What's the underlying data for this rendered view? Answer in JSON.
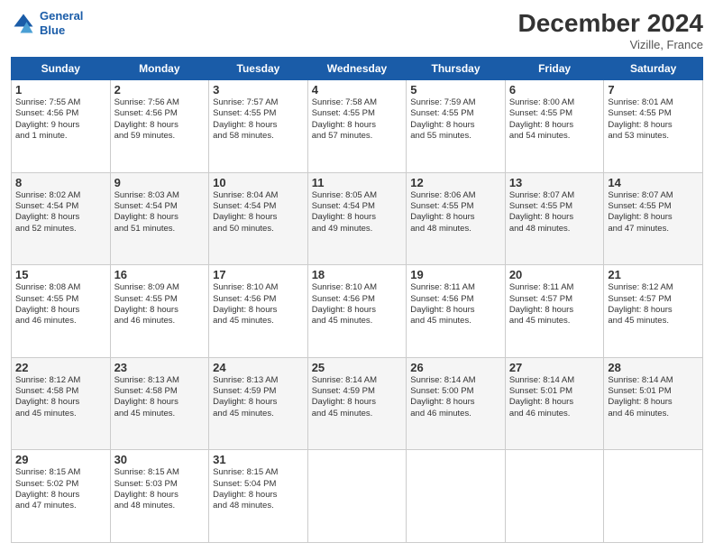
{
  "header": {
    "logo_line1": "General",
    "logo_line2": "Blue",
    "month": "December 2024",
    "location": "Vizille, France"
  },
  "weekdays": [
    "Sunday",
    "Monday",
    "Tuesday",
    "Wednesday",
    "Thursday",
    "Friday",
    "Saturday"
  ],
  "weeks": [
    [
      {
        "day": 1,
        "info": "Sunrise: 7:55 AM\nSunset: 4:56 PM\nDaylight: 9 hours\nand 1 minute."
      },
      {
        "day": 2,
        "info": "Sunrise: 7:56 AM\nSunset: 4:56 PM\nDaylight: 8 hours\nand 59 minutes."
      },
      {
        "day": 3,
        "info": "Sunrise: 7:57 AM\nSunset: 4:55 PM\nDaylight: 8 hours\nand 58 minutes."
      },
      {
        "day": 4,
        "info": "Sunrise: 7:58 AM\nSunset: 4:55 PM\nDaylight: 8 hours\nand 57 minutes."
      },
      {
        "day": 5,
        "info": "Sunrise: 7:59 AM\nSunset: 4:55 PM\nDaylight: 8 hours\nand 55 minutes."
      },
      {
        "day": 6,
        "info": "Sunrise: 8:00 AM\nSunset: 4:55 PM\nDaylight: 8 hours\nand 54 minutes."
      },
      {
        "day": 7,
        "info": "Sunrise: 8:01 AM\nSunset: 4:55 PM\nDaylight: 8 hours\nand 53 minutes."
      }
    ],
    [
      {
        "day": 8,
        "info": "Sunrise: 8:02 AM\nSunset: 4:54 PM\nDaylight: 8 hours\nand 52 minutes."
      },
      {
        "day": 9,
        "info": "Sunrise: 8:03 AM\nSunset: 4:54 PM\nDaylight: 8 hours\nand 51 minutes."
      },
      {
        "day": 10,
        "info": "Sunrise: 8:04 AM\nSunset: 4:54 PM\nDaylight: 8 hours\nand 50 minutes."
      },
      {
        "day": 11,
        "info": "Sunrise: 8:05 AM\nSunset: 4:54 PM\nDaylight: 8 hours\nand 49 minutes."
      },
      {
        "day": 12,
        "info": "Sunrise: 8:06 AM\nSunset: 4:55 PM\nDaylight: 8 hours\nand 48 minutes."
      },
      {
        "day": 13,
        "info": "Sunrise: 8:07 AM\nSunset: 4:55 PM\nDaylight: 8 hours\nand 48 minutes."
      },
      {
        "day": 14,
        "info": "Sunrise: 8:07 AM\nSunset: 4:55 PM\nDaylight: 8 hours\nand 47 minutes."
      }
    ],
    [
      {
        "day": 15,
        "info": "Sunrise: 8:08 AM\nSunset: 4:55 PM\nDaylight: 8 hours\nand 46 minutes."
      },
      {
        "day": 16,
        "info": "Sunrise: 8:09 AM\nSunset: 4:55 PM\nDaylight: 8 hours\nand 46 minutes."
      },
      {
        "day": 17,
        "info": "Sunrise: 8:10 AM\nSunset: 4:56 PM\nDaylight: 8 hours\nand 45 minutes."
      },
      {
        "day": 18,
        "info": "Sunrise: 8:10 AM\nSunset: 4:56 PM\nDaylight: 8 hours\nand 45 minutes."
      },
      {
        "day": 19,
        "info": "Sunrise: 8:11 AM\nSunset: 4:56 PM\nDaylight: 8 hours\nand 45 minutes."
      },
      {
        "day": 20,
        "info": "Sunrise: 8:11 AM\nSunset: 4:57 PM\nDaylight: 8 hours\nand 45 minutes."
      },
      {
        "day": 21,
        "info": "Sunrise: 8:12 AM\nSunset: 4:57 PM\nDaylight: 8 hours\nand 45 minutes."
      }
    ],
    [
      {
        "day": 22,
        "info": "Sunrise: 8:12 AM\nSunset: 4:58 PM\nDaylight: 8 hours\nand 45 minutes."
      },
      {
        "day": 23,
        "info": "Sunrise: 8:13 AM\nSunset: 4:58 PM\nDaylight: 8 hours\nand 45 minutes."
      },
      {
        "day": 24,
        "info": "Sunrise: 8:13 AM\nSunset: 4:59 PM\nDaylight: 8 hours\nand 45 minutes."
      },
      {
        "day": 25,
        "info": "Sunrise: 8:14 AM\nSunset: 4:59 PM\nDaylight: 8 hours\nand 45 minutes."
      },
      {
        "day": 26,
        "info": "Sunrise: 8:14 AM\nSunset: 5:00 PM\nDaylight: 8 hours\nand 46 minutes."
      },
      {
        "day": 27,
        "info": "Sunrise: 8:14 AM\nSunset: 5:01 PM\nDaylight: 8 hours\nand 46 minutes."
      },
      {
        "day": 28,
        "info": "Sunrise: 8:14 AM\nSunset: 5:01 PM\nDaylight: 8 hours\nand 46 minutes."
      }
    ],
    [
      {
        "day": 29,
        "info": "Sunrise: 8:15 AM\nSunset: 5:02 PM\nDaylight: 8 hours\nand 47 minutes."
      },
      {
        "day": 30,
        "info": "Sunrise: 8:15 AM\nSunset: 5:03 PM\nDaylight: 8 hours\nand 48 minutes."
      },
      {
        "day": 31,
        "info": "Sunrise: 8:15 AM\nSunset: 5:04 PM\nDaylight: 8 hours\nand 48 minutes."
      },
      null,
      null,
      null,
      null
    ]
  ]
}
